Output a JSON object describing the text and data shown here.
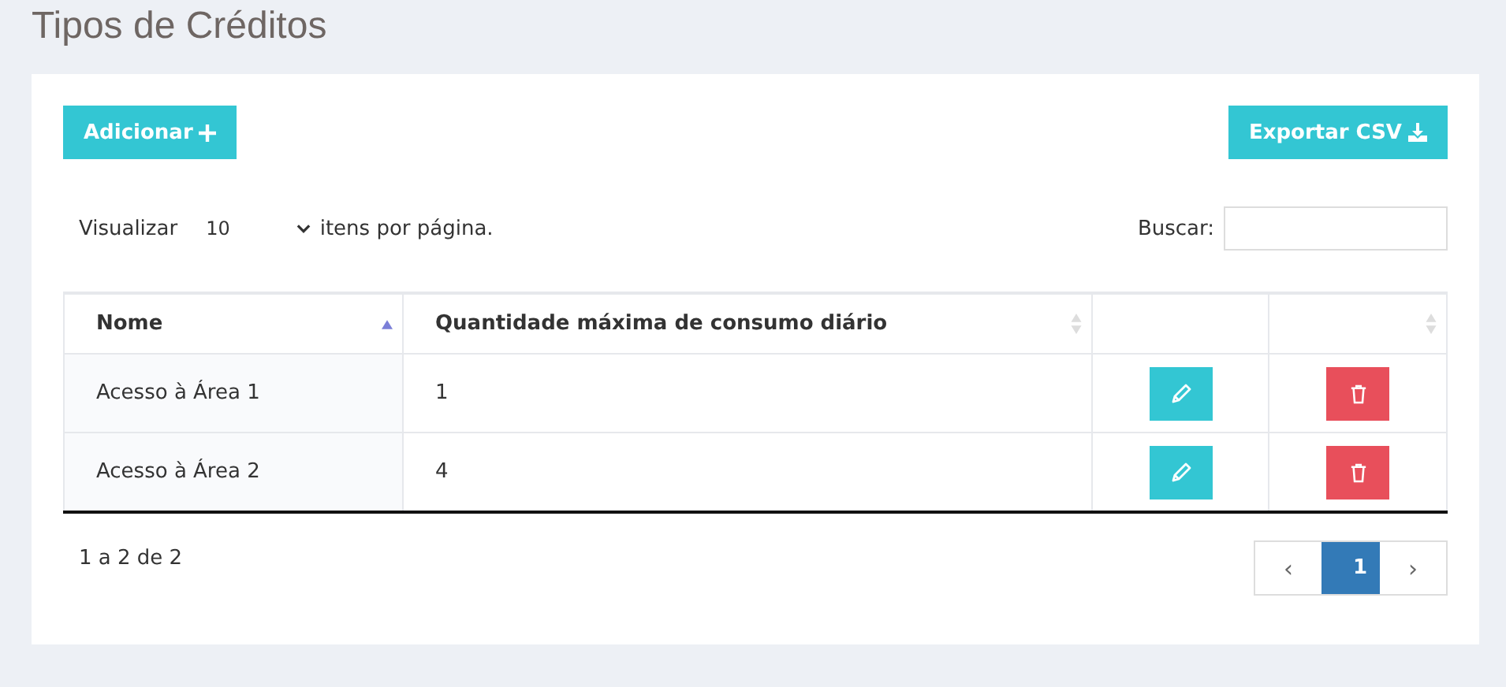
{
  "page_title": "Tipos de Créditos",
  "toolbar": {
    "add_button": "Adicionar",
    "export_button": "Exportar CSV"
  },
  "page_size": {
    "label": "Visualizar",
    "value": "10",
    "suffix": "itens por página."
  },
  "search": {
    "label": "Buscar:"
  },
  "table": {
    "columns": [
      {
        "label": "Nome",
        "sortable": true,
        "sorted": true
      },
      {
        "label": "Quantidade máxima de consumo diário",
        "sortable": true,
        "sorted": false
      },
      {
        "sortable": false
      },
      {
        "sortable": true,
        "sorted": false
      }
    ],
    "rows": [
      {
        "name": "Acesso à Área 1",
        "quantity": "1"
      },
      {
        "name": "Acesso à Área 2",
        "quantity": "4"
      }
    ]
  },
  "footer": {
    "info": "1 a 2 de 2",
    "pagination": [
      {
        "kind": "prev",
        "label": "‹",
        "selected": false
      },
      {
        "kind": "page",
        "label": "1",
        "selected": true
      },
      {
        "kind": "next",
        "label": "›",
        "selected": false
      }
    ]
  }
}
